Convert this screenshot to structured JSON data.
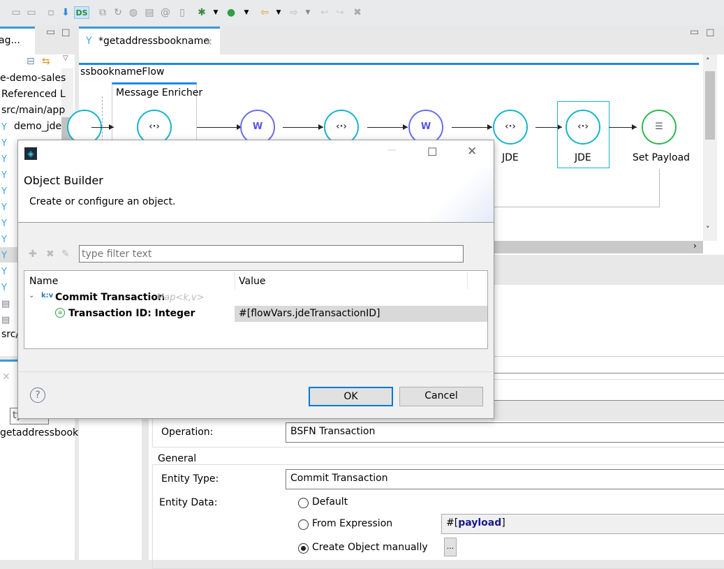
{
  "toolbar": {
    "icons": [
      "save-icon",
      "save-all-icon",
      "camera-icon",
      "deploy-icon",
      "ds-icon",
      "copy-icon",
      "refresh-icon",
      "db-icon",
      "file-icon",
      "mail-icon",
      "clean-icon",
      "debug-icon",
      "run-icon",
      "back-icon",
      "forward-icon",
      "undo-icon",
      "redo-icon",
      "delete-icon"
    ]
  },
  "left_panel": {
    "tab_label": "ag...",
    "tree": [
      "e-demo-sales",
      "Referenced L",
      "src/main/app",
      "demo_jde",
      "src/"
    ],
    "lower_filter": "ty",
    "lower_item": "getaddressbook"
  },
  "editor": {
    "tab_label": "*getaddressbookname",
    "flow_name": "ssbooknameFlow",
    "scope_label": "Message Enricher",
    "nodes": [
      {
        "label": "JDE"
      },
      {
        "label": "JDE"
      },
      {
        "label": "Set Payload"
      }
    ]
  },
  "properties": {
    "operation_label": "Operation:",
    "operation_value": "BSFN Transaction",
    "group_label": "General",
    "entity_type_label": "Entity Type:",
    "entity_type_value": "Commit Transaction",
    "entity_data_label": "Entity Data:",
    "radio_default": "Default",
    "radio_expression": "From Expression",
    "expression_prefix": "#[",
    "expression_keyword": "payload",
    "expression_suffix": "]",
    "radio_manual": "Create Object manually",
    "manual_selected": true,
    "browse_label": "..."
  },
  "dialog": {
    "title": "Object Builder",
    "subtitle": "Create or configure an object.",
    "filter_placeholder": "type filter text",
    "columns": [
      "Name",
      "Value"
    ],
    "root": {
      "name": "Commit Transaction",
      "type": "Map<k,v>",
      "badge": "k:v"
    },
    "child": {
      "name": "Transaction ID: Integer",
      "value": "#[flowVars.jdeTransactionID]",
      "badge": "a"
    },
    "ok_label": "OK",
    "cancel_label": "Cancel",
    "help": "?"
  }
}
